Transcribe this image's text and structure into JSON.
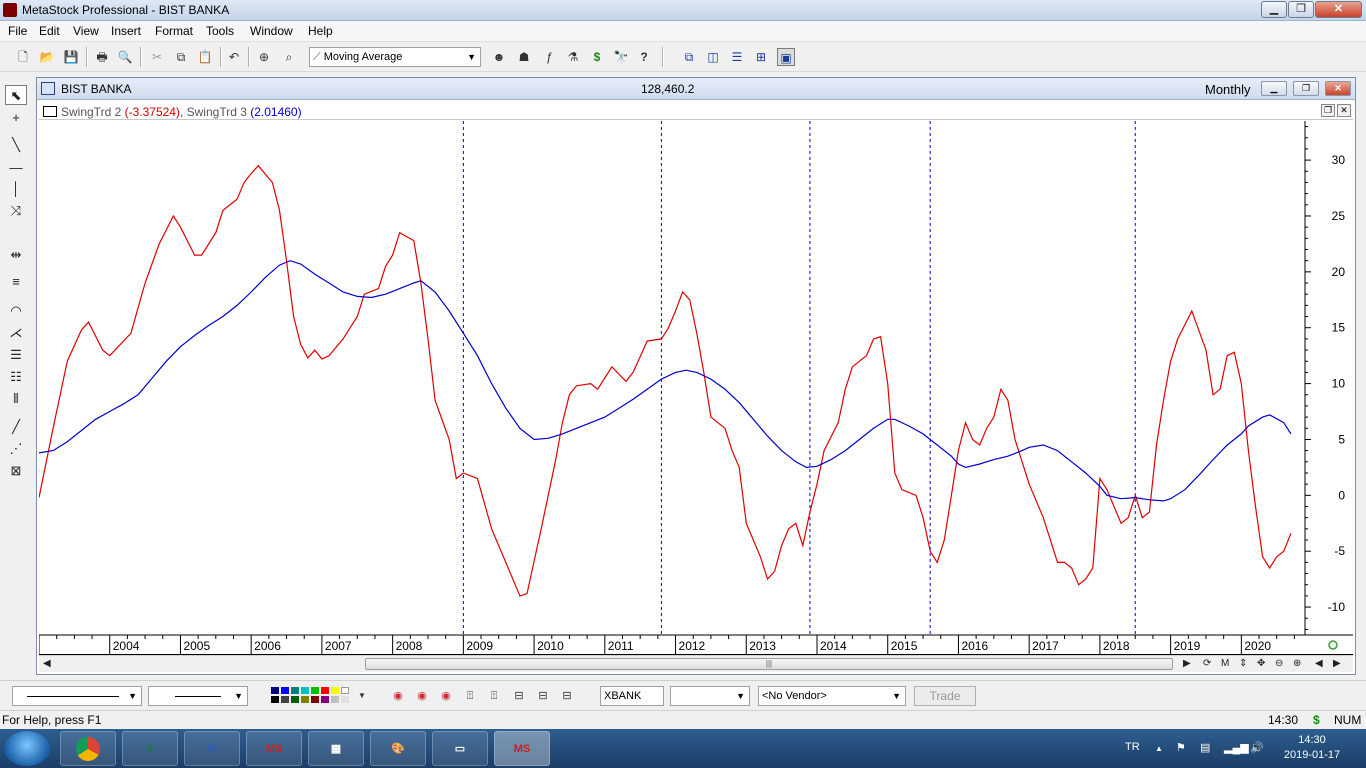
{
  "window": {
    "title": "MetaStock Professional - BIST BANKA"
  },
  "menu": [
    "File",
    "Edit",
    "View",
    "Insert",
    "Format",
    "Tools",
    "Window",
    "Help"
  ],
  "toolbar": {
    "indicator_select": "Moving Average"
  },
  "chart_window": {
    "name": "BIST BANKA",
    "price": "128,460.2",
    "period": "Monthly"
  },
  "indicator_legend": {
    "series1_name": "SwingTrd 2",
    "series1_value": "(-3.37524)",
    "separator": ", ",
    "series2_name": "SwingTrd 3",
    "series2_value": "(2.01460)"
  },
  "chart_data": {
    "type": "line",
    "xlim": [
      2003.0,
      2020.9
    ],
    "ylim": [
      -12.5,
      33.5
    ],
    "x_ticks": [
      "2004",
      "2005",
      "2006",
      "2007",
      "2008",
      "2009",
      "2010",
      "2011",
      "2012",
      "2013",
      "2014",
      "2015",
      "2016",
      "2017",
      "2018",
      "2019",
      "2020"
    ],
    "y_ticks": [
      30,
      25,
      20,
      15,
      10,
      5,
      0,
      -5,
      -10
    ],
    "vertical_markers": [
      2009.0,
      2011.8,
      2013.9,
      2015.6,
      2018.5
    ],
    "colors": {
      "series1": "#e00000",
      "series2": "#0000cc",
      "markers": "#0000cc"
    },
    "series": [
      {
        "name": "SwingTrd 2",
        "points": [
          [
            2003.0,
            -0.2
          ],
          [
            2003.2,
            6.0
          ],
          [
            2003.4,
            12.0
          ],
          [
            2003.6,
            14.8
          ],
          [
            2003.7,
            15.5
          ],
          [
            2003.9,
            13.0
          ],
          [
            2004.0,
            12.5
          ],
          [
            2004.3,
            14.5
          ],
          [
            2004.5,
            19.0
          ],
          [
            2004.7,
            22.5
          ],
          [
            2004.9,
            25.0
          ],
          [
            2005.0,
            24.0
          ],
          [
            2005.2,
            21.5
          ],
          [
            2005.3,
            21.5
          ],
          [
            2005.5,
            23.5
          ],
          [
            2005.6,
            25.5
          ],
          [
            2005.8,
            26.5
          ],
          [
            2005.9,
            28.0
          ],
          [
            2006.0,
            28.8
          ],
          [
            2006.1,
            29.5
          ],
          [
            2006.3,
            28.0
          ],
          [
            2006.4,
            25.5
          ],
          [
            2006.5,
            21.0
          ],
          [
            2006.6,
            16.0
          ],
          [
            2006.7,
            13.5
          ],
          [
            2006.8,
            12.3
          ],
          [
            2006.9,
            13.0
          ],
          [
            2007.0,
            12.2
          ],
          [
            2007.1,
            12.5
          ],
          [
            2007.3,
            14.0
          ],
          [
            2007.5,
            16.0
          ],
          [
            2007.6,
            18.0
          ],
          [
            2007.8,
            18.5
          ],
          [
            2007.9,
            20.5
          ],
          [
            2008.0,
            21.5
          ],
          [
            2008.1,
            23.5
          ],
          [
            2008.3,
            22.8
          ],
          [
            2008.4,
            19.0
          ],
          [
            2008.5,
            14.0
          ],
          [
            2008.6,
            8.5
          ],
          [
            2008.8,
            5.0
          ],
          [
            2008.9,
            1.5
          ],
          [
            2009.0,
            2.0
          ],
          [
            2009.2,
            1.5
          ],
          [
            2009.4,
            -3.0
          ],
          [
            2009.6,
            -6.0
          ],
          [
            2009.8,
            -9.0
          ],
          [
            2009.9,
            -8.8
          ],
          [
            2010.1,
            -3.0
          ],
          [
            2010.3,
            3.0
          ],
          [
            2010.4,
            6.5
          ],
          [
            2010.5,
            9.0
          ],
          [
            2010.6,
            9.8
          ],
          [
            2010.8,
            10.0
          ],
          [
            2010.9,
            9.5
          ],
          [
            2011.0,
            10.5
          ],
          [
            2011.1,
            11.5
          ],
          [
            2011.3,
            10.2
          ],
          [
            2011.4,
            11.0
          ],
          [
            2011.6,
            13.8
          ],
          [
            2011.8,
            14.0
          ],
          [
            2011.9,
            15.0
          ],
          [
            2012.0,
            16.5
          ],
          [
            2012.1,
            18.2
          ],
          [
            2012.2,
            17.5
          ],
          [
            2012.3,
            14.5
          ],
          [
            2012.4,
            11.0
          ],
          [
            2012.5,
            7.0
          ],
          [
            2012.7,
            6.0
          ],
          [
            2012.8,
            4.0
          ],
          [
            2012.9,
            2.5
          ],
          [
            2013.0,
            -2.5
          ],
          [
            2013.2,
            -5.5
          ],
          [
            2013.3,
            -7.5
          ],
          [
            2013.4,
            -6.8
          ],
          [
            2013.5,
            -4.5
          ],
          [
            2013.6,
            -3.0
          ],
          [
            2013.7,
            -2.5
          ],
          [
            2013.8,
            -4.5
          ],
          [
            2013.9,
            -1.5
          ],
          [
            2014.0,
            1.0
          ],
          [
            2014.1,
            4.0
          ],
          [
            2014.3,
            6.5
          ],
          [
            2014.4,
            9.5
          ],
          [
            2014.5,
            11.5
          ],
          [
            2014.6,
            12.0
          ],
          [
            2014.7,
            12.5
          ],
          [
            2014.8,
            14.0
          ],
          [
            2014.9,
            14.2
          ],
          [
            2015.0,
            10.0
          ],
          [
            2015.1,
            2.0
          ],
          [
            2015.2,
            0.5
          ],
          [
            2015.4,
            0.0
          ],
          [
            2015.5,
            -2.0
          ],
          [
            2015.6,
            -5.0
          ],
          [
            2015.7,
            -6.0
          ],
          [
            2015.8,
            -4.0
          ],
          [
            2015.9,
            0.0
          ],
          [
            2016.0,
            4.0
          ],
          [
            2016.1,
            6.5
          ],
          [
            2016.2,
            5.0
          ],
          [
            2016.3,
            4.5
          ],
          [
            2016.4,
            6.0
          ],
          [
            2016.5,
            7.0
          ],
          [
            2016.6,
            9.5
          ],
          [
            2016.7,
            8.5
          ],
          [
            2016.8,
            5.0
          ],
          [
            2016.9,
            3.0
          ],
          [
            2017.0,
            1.0
          ],
          [
            2017.2,
            -2.0
          ],
          [
            2017.4,
            -6.0
          ],
          [
            2017.5,
            -6.0
          ],
          [
            2017.6,
            -6.5
          ],
          [
            2017.7,
            -8.0
          ],
          [
            2017.8,
            -7.5
          ],
          [
            2017.9,
            -6.5
          ],
          [
            2018.0,
            1.5
          ],
          [
            2018.1,
            0.5
          ],
          [
            2018.2,
            -1.0
          ],
          [
            2018.3,
            -2.5
          ],
          [
            2018.4,
            -2.0
          ],
          [
            2018.5,
            0.0
          ],
          [
            2018.6,
            -2.0
          ],
          [
            2018.7,
            -1.5
          ],
          [
            2018.8,
            4.5
          ],
          [
            2018.9,
            8.5
          ],
          [
            2019.0,
            12.0
          ],
          [
            2019.1,
            14.0
          ],
          [
            2019.3,
            16.5
          ],
          [
            2019.5,
            13.0
          ],
          [
            2019.6,
            9.0
          ],
          [
            2019.7,
            9.5
          ],
          [
            2019.8,
            12.5
          ],
          [
            2019.9,
            12.8
          ],
          [
            2020.0,
            10.0
          ],
          [
            2020.1,
            4.0
          ],
          [
            2020.2,
            -1.0
          ],
          [
            2020.3,
            -5.5
          ],
          [
            2020.4,
            -6.5
          ],
          [
            2020.5,
            -5.5
          ],
          [
            2020.6,
            -5.0
          ],
          [
            2020.7,
            -3.4
          ]
        ]
      },
      {
        "name": "SwingTrd 3",
        "points": [
          [
            2003.0,
            3.8
          ],
          [
            2003.2,
            4.0
          ],
          [
            2003.4,
            4.8
          ],
          [
            2003.6,
            5.8
          ],
          [
            2003.8,
            6.8
          ],
          [
            2004.0,
            7.5
          ],
          [
            2004.2,
            8.2
          ],
          [
            2004.4,
            9.0
          ],
          [
            2004.6,
            10.5
          ],
          [
            2004.8,
            12.0
          ],
          [
            2005.0,
            13.3
          ],
          [
            2005.2,
            14.3
          ],
          [
            2005.4,
            15.2
          ],
          [
            2005.6,
            16.0
          ],
          [
            2005.8,
            17.0
          ],
          [
            2006.0,
            18.2
          ],
          [
            2006.2,
            19.5
          ],
          [
            2006.4,
            20.6
          ],
          [
            2006.55,
            21.0
          ],
          [
            2006.7,
            20.7
          ],
          [
            2006.9,
            19.8
          ],
          [
            2007.1,
            19.0
          ],
          [
            2007.3,
            18.2
          ],
          [
            2007.5,
            17.8
          ],
          [
            2007.7,
            17.7
          ],
          [
            2007.9,
            18.0
          ],
          [
            2008.1,
            18.5
          ],
          [
            2008.3,
            19.0
          ],
          [
            2008.4,
            19.2
          ],
          [
            2008.6,
            18.2
          ],
          [
            2008.8,
            16.5
          ],
          [
            2009.0,
            14.5
          ],
          [
            2009.2,
            12.5
          ],
          [
            2009.4,
            10.0
          ],
          [
            2009.6,
            7.8
          ],
          [
            2009.8,
            6.0
          ],
          [
            2010.0,
            5.0
          ],
          [
            2010.2,
            5.1
          ],
          [
            2010.4,
            5.5
          ],
          [
            2010.6,
            6.0
          ],
          [
            2010.8,
            6.5
          ],
          [
            2011.0,
            7.0
          ],
          [
            2011.2,
            7.8
          ],
          [
            2011.4,
            8.6
          ],
          [
            2011.6,
            9.5
          ],
          [
            2011.8,
            10.4
          ],
          [
            2012.0,
            11.0
          ],
          [
            2012.15,
            11.2
          ],
          [
            2012.3,
            11.0
          ],
          [
            2012.5,
            10.4
          ],
          [
            2012.7,
            9.5
          ],
          [
            2012.9,
            8.3
          ],
          [
            2013.1,
            6.8
          ],
          [
            2013.3,
            5.3
          ],
          [
            2013.5,
            4.0
          ],
          [
            2013.7,
            3.0
          ],
          [
            2013.85,
            2.5
          ],
          [
            2014.0,
            2.6
          ],
          [
            2014.2,
            3.2
          ],
          [
            2014.4,
            4.0
          ],
          [
            2014.6,
            5.0
          ],
          [
            2014.8,
            6.0
          ],
          [
            2015.0,
            6.8
          ],
          [
            2015.1,
            6.8
          ],
          [
            2015.3,
            6.2
          ],
          [
            2015.5,
            5.5
          ],
          [
            2015.7,
            4.5
          ],
          [
            2015.9,
            3.5
          ],
          [
            2016.0,
            2.8
          ],
          [
            2016.1,
            2.5
          ],
          [
            2016.3,
            2.8
          ],
          [
            2016.5,
            3.2
          ],
          [
            2016.7,
            3.5
          ],
          [
            2016.9,
            4.0
          ],
          [
            2017.0,
            4.3
          ],
          [
            2017.2,
            4.5
          ],
          [
            2017.4,
            4.0
          ],
          [
            2017.6,
            3.0
          ],
          [
            2017.8,
            2.0
          ],
          [
            2018.0,
            0.8
          ],
          [
            2018.1,
            0.0
          ],
          [
            2018.3,
            -0.3
          ],
          [
            2018.5,
            -0.2
          ],
          [
            2018.7,
            -0.4
          ],
          [
            2018.9,
            -0.5
          ],
          [
            2019.0,
            -0.3
          ],
          [
            2019.2,
            0.5
          ],
          [
            2019.4,
            1.8
          ],
          [
            2019.6,
            3.2
          ],
          [
            2019.8,
            4.5
          ],
          [
            2020.0,
            5.5
          ],
          [
            2020.1,
            6.2
          ],
          [
            2020.3,
            7.0
          ],
          [
            2020.4,
            7.2
          ],
          [
            2020.6,
            6.5
          ],
          [
            2020.7,
            5.5
          ]
        ]
      }
    ]
  },
  "bottombar": {
    "symbol": "XBANK",
    "vendor": "<No Vendor>",
    "trade": "Trade"
  },
  "status": {
    "help": "For Help, press F1",
    "time": "14:30",
    "dollar": "$",
    "num": "NUM"
  },
  "taskbar": {
    "apps": [
      "chrome-icon",
      "excel-icon",
      "word-icon",
      "ms-icon",
      "calculator-icon",
      "paint-icon",
      "notepad-icon",
      "metastock-icon"
    ],
    "lang": "TR",
    "clock_time": "14:30",
    "clock_date": "2019-01-17"
  }
}
